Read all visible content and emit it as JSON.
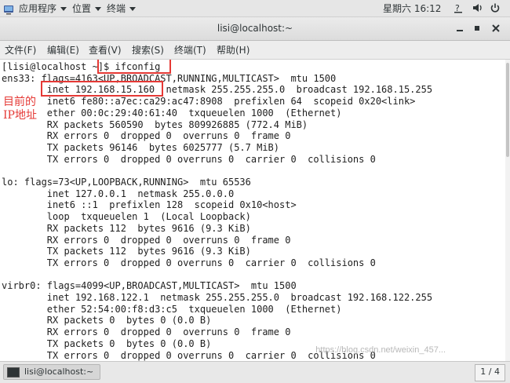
{
  "topbar": {
    "applications": "应用程序",
    "places": "位置",
    "terminal": "终端",
    "clock": "星期六 16:12",
    "icons": [
      "help-icon",
      "volume-icon",
      "power-icon"
    ]
  },
  "window": {
    "title": "lisi@localhost:~",
    "buttons": [
      "minimize-icon",
      "maximize-icon",
      "close-icon"
    ]
  },
  "menu": {
    "file": "文件(F)",
    "edit": "编辑(E)",
    "view": "查看(V)",
    "search": "搜索(S)",
    "terminal": "终端(T)",
    "help": "帮助(H)"
  },
  "terminal": {
    "lines": [
      "[lisi@localhost ~]$ ifconfig",
      "ens33: flags=4163<UP,BROADCAST,RUNNING,MULTICAST>  mtu 1500",
      "        inet 192.168.15.160  netmask 255.255.255.0  broadcast 192.168.15.255",
      "        inet6 fe80::a7ec:ca29:ac47:8908  prefixlen 64  scopeid 0x20<link>",
      "        ether 00:0c:29:40:61:40  txqueuelen 1000  (Ethernet)",
      "        RX packets 560590  bytes 809926885 (772.4 MiB)",
      "        RX errors 0  dropped 0  overruns 0  frame 0",
      "        TX packets 96146  bytes 6025777 (5.7 MiB)",
      "        TX errors 0  dropped 0 overruns 0  carrier 0  collisions 0",
      "",
      "lo: flags=73<UP,LOOPBACK,RUNNING>  mtu 65536",
      "        inet 127.0.0.1  netmask 255.0.0.0",
      "        inet6 ::1  prefixlen 128  scopeid 0x10<host>",
      "        loop  txqueuelen 1  (Local Loopback)",
      "        RX packets 112  bytes 9616 (9.3 KiB)",
      "        RX errors 0  dropped 0  overruns 0  frame 0",
      "        TX packets 112  bytes 9616 (9.3 KiB)",
      "        TX errors 0  dropped 0 overruns 0  carrier 0  collisions 0",
      "",
      "virbr0: flags=4099<UP,BROADCAST,MULTICAST>  mtu 1500",
      "        inet 192.168.122.1  netmask 255.255.255.0  broadcast 192.168.122.255",
      "        ether 52:54:00:f8:d3:c5  txqueuelen 1000  (Ethernet)",
      "        RX packets 0  bytes 0 (0.0 B)",
      "        RX errors 0  dropped 0  overruns 0  frame 0",
      "        TX packets 0  bytes 0 (0.0 B)",
      "        TX errors 0  dropped 0 overruns 0  carrier 0  collisions 0"
    ],
    "annotation": [
      "目前的",
      "IP地址"
    ],
    "annotation_color": "#e53935"
  },
  "watermark": "https://blog.csdn.net/weixin_457...",
  "taskbar": {
    "task_label": "lisi@localhost:~",
    "pager": "1 / 4"
  }
}
